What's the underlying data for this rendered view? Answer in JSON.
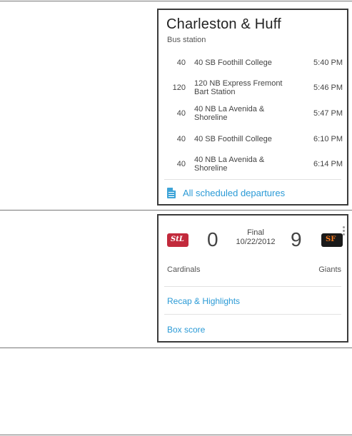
{
  "transit_card": {
    "stop_name": "Charleston & Huff",
    "stop_type": "Bus station",
    "departures": [
      {
        "route": "40",
        "destination": "40 SB Foothill College",
        "time": "5:40 PM"
      },
      {
        "route": "120",
        "destination": "120 NB Express Fremont Bart Station",
        "time": "5:46 PM"
      },
      {
        "route": "40",
        "destination": "40 NB La Avenida & Shoreline",
        "time": "5:47 PM"
      },
      {
        "route": "40",
        "destination": "40 SB Foothill College",
        "time": "6:10 PM"
      },
      {
        "route": "40",
        "destination": "40 NB La Avenida & Shoreline",
        "time": "6:14 PM"
      }
    ],
    "all_departures_label": "All scheduled departures",
    "icon": "document-icon",
    "accent_color": "#2a9ad6"
  },
  "sports_card": {
    "home_team": {
      "name": "Cardinals",
      "score": "0",
      "logo_icon": "cardinals-logo-icon",
      "color": "#c22a3c"
    },
    "away_team": {
      "name": "Giants",
      "score": "9",
      "logo_icon": "giants-logo-icon",
      "color": "#f47a20"
    },
    "status": "Final",
    "date": "10/22/2012",
    "links": [
      {
        "label": "Recap & Highlights"
      },
      {
        "label": "Box score"
      }
    ],
    "overflow_icon": "overflow-menu-icon"
  }
}
